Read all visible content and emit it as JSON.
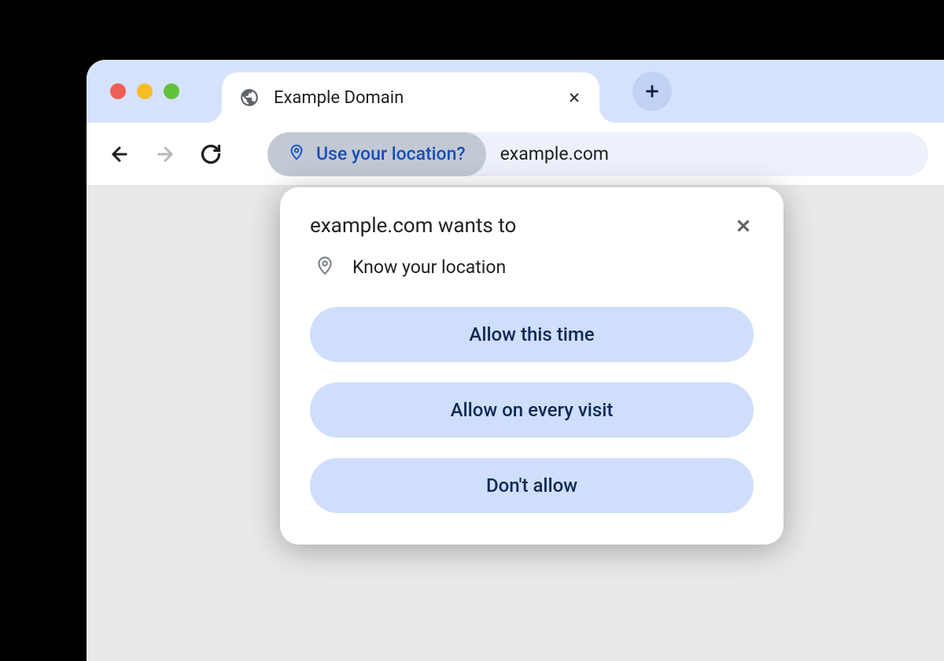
{
  "tab": {
    "title": "Example Domain"
  },
  "address_bar": {
    "chip_text": "Use your location?",
    "url": "example.com"
  },
  "popup": {
    "title": "example.com wants to",
    "permission_text": "Know your location",
    "buttons": {
      "allow_once": "Allow this time",
      "allow_always": "Allow on every visit",
      "deny": "Don't allow"
    }
  }
}
